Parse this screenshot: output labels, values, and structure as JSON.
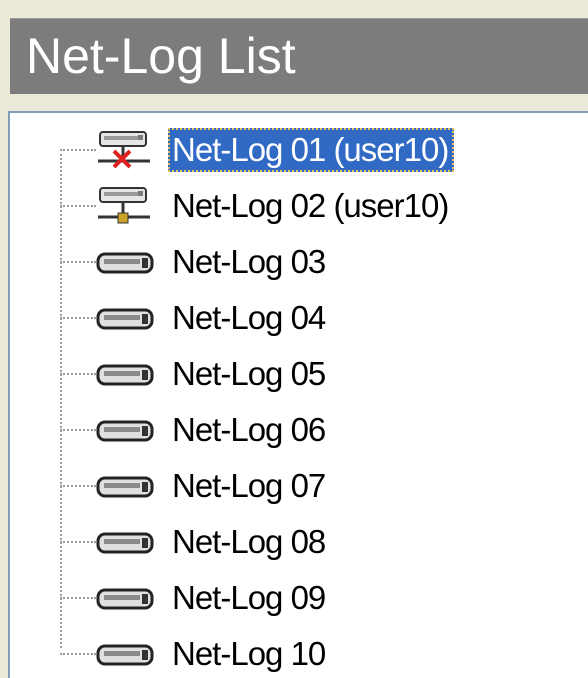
{
  "header": {
    "title": "Net-Log List"
  },
  "colors": {
    "title_bar": "#7c7c7c",
    "selection": "#316ac5",
    "panel_border": "#7f9db9"
  },
  "tree": {
    "items": [
      {
        "label": "Net-Log 01 (user10)",
        "icon": "server-disconnected-icon",
        "selected": true
      },
      {
        "label": "Net-Log 02 (user10)",
        "icon": "server-connected-icon",
        "selected": false
      },
      {
        "label": "Net-Log 03",
        "icon": "drive-icon",
        "selected": false
      },
      {
        "label": "Net-Log 04",
        "icon": "drive-icon",
        "selected": false
      },
      {
        "label": "Net-Log 05",
        "icon": "drive-icon",
        "selected": false
      },
      {
        "label": "Net-Log 06",
        "icon": "drive-icon",
        "selected": false
      },
      {
        "label": "Net-Log 07",
        "icon": "drive-icon",
        "selected": false
      },
      {
        "label": "Net-Log 08",
        "icon": "drive-icon",
        "selected": false
      },
      {
        "label": "Net-Log 09",
        "icon": "drive-icon",
        "selected": false
      },
      {
        "label": "Net-Log 10",
        "icon": "drive-icon",
        "selected": false
      }
    ]
  }
}
